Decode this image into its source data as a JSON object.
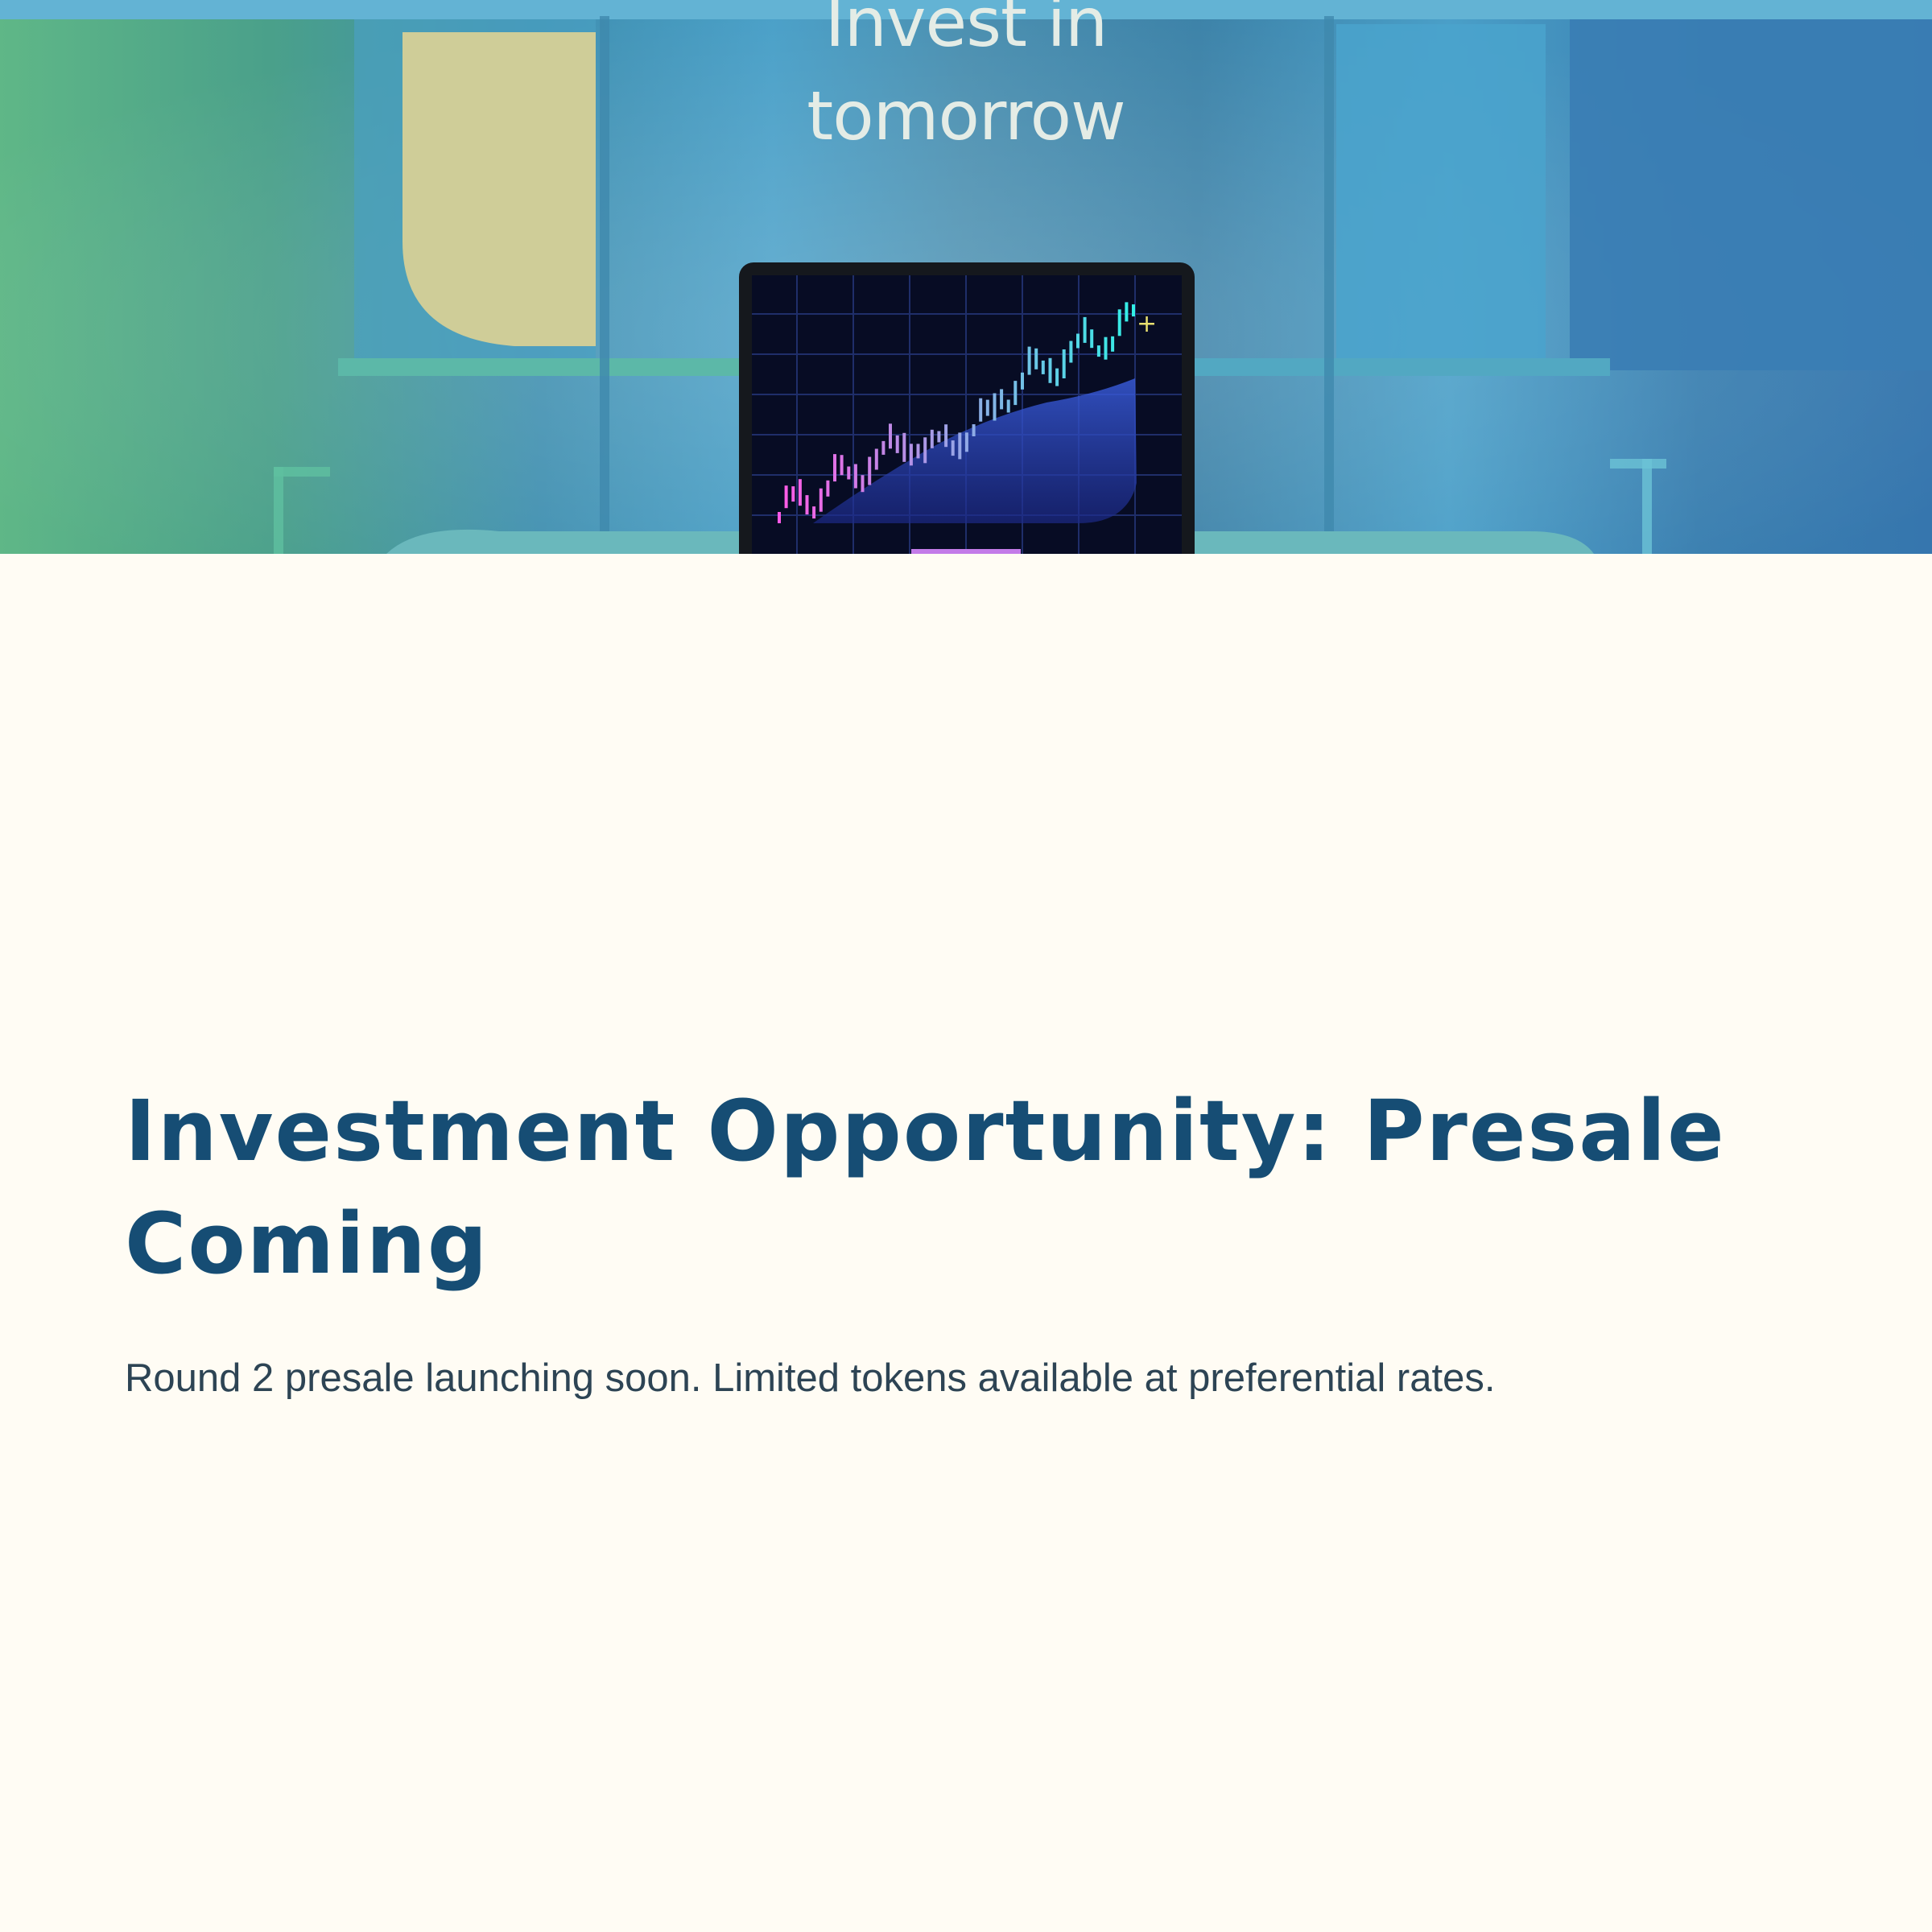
{
  "hero": {
    "headline_line1": "Invest in",
    "headline_line2": "tomorrow",
    "image_subject": "tablet-candlestick-chart"
  },
  "content": {
    "title": "Investment Opportunity: Presale Coming",
    "subtitle": "Round 2 presale launching soon. Limited tokens available at preferential rates."
  },
  "colors": {
    "background": "#fffcf4",
    "title": "#164d74",
    "body_text": "#2d4454"
  }
}
